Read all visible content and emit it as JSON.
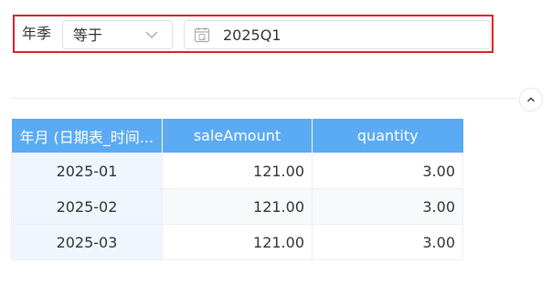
{
  "filter": {
    "label": "年季",
    "operator": "等于",
    "value": "2025Q1",
    "border_color": "#e0202a"
  },
  "icons": {
    "operator_dropdown": "chevron-down-icon",
    "date_input": "calendar-icon",
    "collapse": "chevron-up-icon"
  },
  "table": {
    "header_color": "#5aaaf4",
    "columns": [
      "年月 (日期表_时间...",
      "saleAmount",
      "quantity"
    ],
    "rows": [
      [
        "2025-01",
        "121.00",
        "3.00"
      ],
      [
        "2025-02",
        "121.00",
        "3.00"
      ],
      [
        "2025-03",
        "121.00",
        "3.00"
      ]
    ]
  }
}
